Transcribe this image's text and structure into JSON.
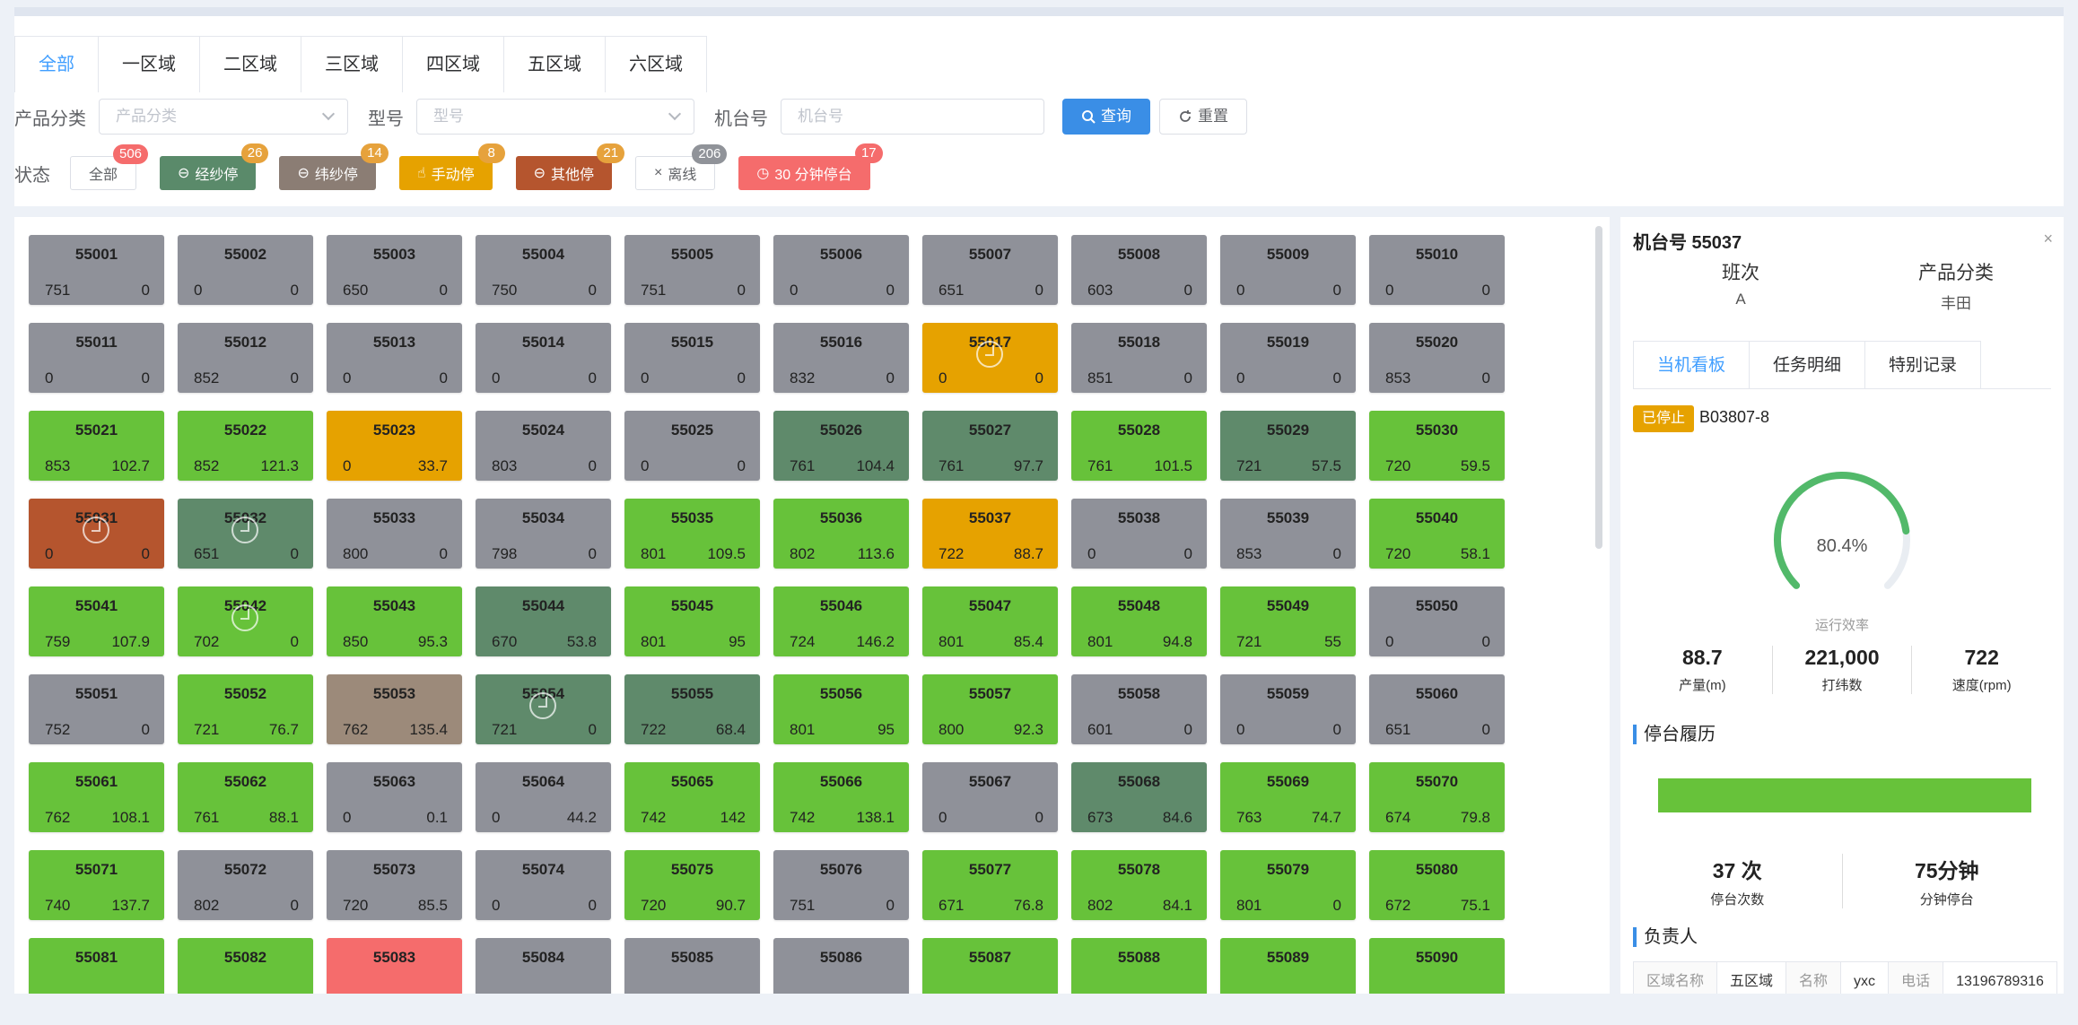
{
  "tabs": [
    "全部",
    "一区域",
    "二区域",
    "三区域",
    "四区域",
    "五区域",
    "六区域"
  ],
  "filters": {
    "product_label": "产品分类",
    "product_placeholder": "产品分类",
    "model_label": "型号",
    "model_placeholder": "型号",
    "machine_label": "机台号",
    "machine_placeholder": "机台号",
    "query": "查询",
    "reset": "重置"
  },
  "status": {
    "label": "状态",
    "items": [
      {
        "label": "全部",
        "count": "506",
        "color": "#ffffff",
        "badge": "#f56c6c",
        "icon": ""
      },
      {
        "label": "经纱停",
        "count": "26",
        "color": "#5a8a6a",
        "badge": "#e6a23c",
        "icon": "minus-circle"
      },
      {
        "label": "纬纱停",
        "count": "14",
        "color": "#8b7d74",
        "badge": "#e6a23c",
        "icon": "minus-circle"
      },
      {
        "label": "手动停",
        "count": "8",
        "color": "#e6a200",
        "badge": "#e6a23c",
        "icon": "hand"
      },
      {
        "label": "其他停",
        "count": "21",
        "color": "#b5552e",
        "badge": "#e6a23c",
        "icon": "minus-circle"
      },
      {
        "label": "离线",
        "count": "206",
        "color": "#ffffff",
        "badge": "#909399",
        "icon": "close"
      },
      {
        "label": "30 分钟停台",
        "count": "17",
        "color": "#f56c6c",
        "badge": "#f56c6c",
        "icon": "clock"
      }
    ]
  },
  "machines": [
    {
      "id": "55001",
      "l": "751",
      "r": "0",
      "s": "gray"
    },
    {
      "id": "55002",
      "l": "0",
      "r": "0",
      "s": "gray"
    },
    {
      "id": "55003",
      "l": "650",
      "r": "0",
      "s": "gray"
    },
    {
      "id": "55004",
      "l": "750",
      "r": "0",
      "s": "gray"
    },
    {
      "id": "55005",
      "l": "751",
      "r": "0",
      "s": "gray"
    },
    {
      "id": "55006",
      "l": "0",
      "r": "0",
      "s": "gray"
    },
    {
      "id": "55007",
      "l": "651",
      "r": "0",
      "s": "gray"
    },
    {
      "id": "55008",
      "l": "603",
      "r": "0",
      "s": "gray"
    },
    {
      "id": "55009",
      "l": "0",
      "r": "0",
      "s": "gray"
    },
    {
      "id": "55010",
      "l": "0",
      "r": "0",
      "s": "gray"
    },
    {
      "id": "55011",
      "l": "0",
      "r": "0",
      "s": "gray"
    },
    {
      "id": "55012",
      "l": "852",
      "r": "0",
      "s": "gray"
    },
    {
      "id": "55013",
      "l": "0",
      "r": "0",
      "s": "gray"
    },
    {
      "id": "55014",
      "l": "0",
      "r": "0",
      "s": "gray"
    },
    {
      "id": "55015",
      "l": "0",
      "r": "0",
      "s": "gray"
    },
    {
      "id": "55016",
      "l": "832",
      "r": "0",
      "s": "gray"
    },
    {
      "id": "55017",
      "l": "0",
      "r": "0",
      "s": "orange",
      "ring": true
    },
    {
      "id": "55018",
      "l": "851",
      "r": "0",
      "s": "gray"
    },
    {
      "id": "55019",
      "l": "0",
      "r": "0",
      "s": "gray"
    },
    {
      "id": "55020",
      "l": "853",
      "r": "0",
      "s": "gray"
    },
    {
      "id": "55021",
      "l": "853",
      "r": "102.7",
      "s": "green"
    },
    {
      "id": "55022",
      "l": "852",
      "r": "121.3",
      "s": "green"
    },
    {
      "id": "55023",
      "l": "0",
      "r": "33.7",
      "s": "orange"
    },
    {
      "id": "55024",
      "l": "803",
      "r": "0",
      "s": "gray"
    },
    {
      "id": "55025",
      "l": "0",
      "r": "0",
      "s": "gray"
    },
    {
      "id": "55026",
      "l": "761",
      "r": "104.4",
      "s": "darkgreen"
    },
    {
      "id": "55027",
      "l": "761",
      "r": "97.7",
      "s": "darkgreen"
    },
    {
      "id": "55028",
      "l": "761",
      "r": "101.5",
      "s": "green"
    },
    {
      "id": "55029",
      "l": "721",
      "r": "57.5",
      "s": "darkgreen"
    },
    {
      "id": "55030",
      "l": "720",
      "r": "59.5",
      "s": "green"
    },
    {
      "id": "55031",
      "l": "0",
      "r": "0",
      "s": "brown",
      "ring": true
    },
    {
      "id": "55032",
      "l": "651",
      "r": "0",
      "s": "darkgreen",
      "ring": true
    },
    {
      "id": "55033",
      "l": "800",
      "r": "0",
      "s": "gray"
    },
    {
      "id": "55034",
      "l": "798",
      "r": "0",
      "s": "gray"
    },
    {
      "id": "55035",
      "l": "801",
      "r": "109.5",
      "s": "green"
    },
    {
      "id": "55036",
      "l": "802",
      "r": "113.6",
      "s": "green"
    },
    {
      "id": "55037",
      "l": "722",
      "r": "88.7",
      "s": "orange"
    },
    {
      "id": "55038",
      "l": "0",
      "r": "0",
      "s": "gray"
    },
    {
      "id": "55039",
      "l": "853",
      "r": "0",
      "s": "gray"
    },
    {
      "id": "55040",
      "l": "720",
      "r": "58.1",
      "s": "green"
    },
    {
      "id": "55041",
      "l": "759",
      "r": "107.9",
      "s": "green"
    },
    {
      "id": "55042",
      "l": "702",
      "r": "0",
      "s": "green",
      "ring": true
    },
    {
      "id": "55043",
      "l": "850",
      "r": "95.3",
      "s": "green"
    },
    {
      "id": "55044",
      "l": "670",
      "r": "53.8",
      "s": "darkgreen"
    },
    {
      "id": "55045",
      "l": "801",
      "r": "95",
      "s": "green"
    },
    {
      "id": "55046",
      "l": "724",
      "r": "146.2",
      "s": "green"
    },
    {
      "id": "55047",
      "l": "801",
      "r": "85.4",
      "s": "green"
    },
    {
      "id": "55048",
      "l": "801",
      "r": "94.8",
      "s": "green"
    },
    {
      "id": "55049",
      "l": "721",
      "r": "55",
      "s": "green"
    },
    {
      "id": "55050",
      "l": "0",
      "r": "0",
      "s": "gray"
    },
    {
      "id": "55051",
      "l": "752",
      "r": "0",
      "s": "gray"
    },
    {
      "id": "55052",
      "l": "721",
      "r": "76.7",
      "s": "green"
    },
    {
      "id": "55053",
      "l": "762",
      "r": "135.4",
      "s": "taupe"
    },
    {
      "id": "55054",
      "l": "721",
      "r": "0",
      "s": "darkgreen",
      "ring": true
    },
    {
      "id": "55055",
      "l": "722",
      "r": "68.4",
      "s": "darkgreen"
    },
    {
      "id": "55056",
      "l": "801",
      "r": "95",
      "s": "green"
    },
    {
      "id": "55057",
      "l": "800",
      "r": "92.3",
      "s": "green"
    },
    {
      "id": "55058",
      "l": "601",
      "r": "0",
      "s": "gray"
    },
    {
      "id": "55059",
      "l": "0",
      "r": "0",
      "s": "gray"
    },
    {
      "id": "55060",
      "l": "651",
      "r": "0",
      "s": "gray"
    },
    {
      "id": "55061",
      "l": "762",
      "r": "108.1",
      "s": "green"
    },
    {
      "id": "55062",
      "l": "761",
      "r": "88.1",
      "s": "green"
    },
    {
      "id": "55063",
      "l": "0",
      "r": "0.1",
      "s": "gray"
    },
    {
      "id": "55064",
      "l": "0",
      "r": "44.2",
      "s": "gray"
    },
    {
      "id": "55065",
      "l": "742",
      "r": "142",
      "s": "green"
    },
    {
      "id": "55066",
      "l": "742",
      "r": "138.1",
      "s": "green"
    },
    {
      "id": "55067",
      "l": "0",
      "r": "0",
      "s": "gray"
    },
    {
      "id": "55068",
      "l": "673",
      "r": "84.6",
      "s": "darkgreen"
    },
    {
      "id": "55069",
      "l": "763",
      "r": "74.7",
      "s": "green"
    },
    {
      "id": "55070",
      "l": "674",
      "r": "79.8",
      "s": "green"
    },
    {
      "id": "55071",
      "l": "740",
      "r": "137.7",
      "s": "green"
    },
    {
      "id": "55072",
      "l": "802",
      "r": "0",
      "s": "gray"
    },
    {
      "id": "55073",
      "l": "720",
      "r": "85.5",
      "s": "gray"
    },
    {
      "id": "55074",
      "l": "0",
      "r": "0",
      "s": "gray"
    },
    {
      "id": "55075",
      "l": "720",
      "r": "90.7",
      "s": "green"
    },
    {
      "id": "55076",
      "l": "751",
      "r": "0",
      "s": "gray"
    },
    {
      "id": "55077",
      "l": "671",
      "r": "76.8",
      "s": "green"
    },
    {
      "id": "55078",
      "l": "802",
      "r": "84.1",
      "s": "green"
    },
    {
      "id": "55079",
      "l": "801",
      "r": "0",
      "s": "green"
    },
    {
      "id": "55080",
      "l": "672",
      "r": "75.1",
      "s": "green"
    },
    {
      "id": "55081",
      "l": "",
      "r": "",
      "s": "green"
    },
    {
      "id": "55082",
      "l": "",
      "r": "",
      "s": "green"
    },
    {
      "id": "55083",
      "l": "",
      "r": "",
      "s": "red"
    },
    {
      "id": "55084",
      "l": "",
      "r": "",
      "s": "gray"
    },
    {
      "id": "55085",
      "l": "",
      "r": "",
      "s": "gray"
    },
    {
      "id": "55086",
      "l": "",
      "r": "",
      "s": "gray"
    },
    {
      "id": "55087",
      "l": "",
      "r": "",
      "s": "green"
    },
    {
      "id": "55088",
      "l": "",
      "r": "",
      "s": "green"
    },
    {
      "id": "55089",
      "l": "",
      "r": "",
      "s": "green"
    },
    {
      "id": "55090",
      "l": "",
      "r": "",
      "s": "green"
    }
  ],
  "state_colors": {
    "gray": "#8f9199",
    "green": "#67c23a",
    "orange": "#e6a200",
    "darkgreen": "#5f8a6b",
    "brown": "#b5552e",
    "taupe": "#9c8a7a",
    "red": "#f56c6c"
  },
  "detail": {
    "title": "机台号 55037",
    "shift_label": "班次",
    "shift_value": "A",
    "category_label": "产品分类",
    "category_value": "丰田",
    "tabs": [
      "当机看板",
      "任务明细",
      "特别记录"
    ],
    "stop_tag": "已停止",
    "order_code": "B03807-8",
    "efficiency": 0.804,
    "efficiency_text": "80.4%",
    "efficiency_label": "运行效率",
    "stats": [
      {
        "value": "88.7",
        "unit": "产量(m)"
      },
      {
        "value": "221,000",
        "unit": "打纬数"
      },
      {
        "value": "722",
        "unit": "速度(rpm)"
      }
    ],
    "history_title": "停台履历",
    "stop_stats": [
      {
        "value": "37 次",
        "unit": "停台次数"
      },
      {
        "value": "75分钟",
        "unit": "分钟停台"
      }
    ],
    "owner_title": "负责人",
    "owner": [
      {
        "k": "区域名称",
        "v": "五区域"
      },
      {
        "k": "名称",
        "v": "yxc"
      },
      {
        "k": "电话",
        "v": "13196789316"
      }
    ]
  }
}
